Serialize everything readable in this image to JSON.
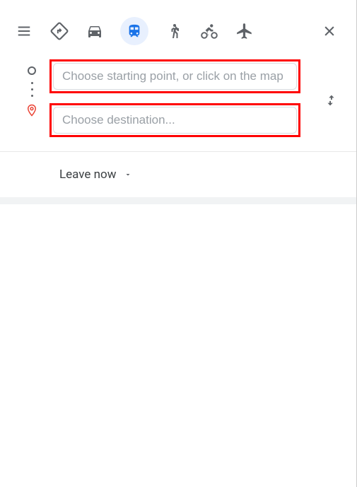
{
  "modes": {
    "best": "best",
    "driving": "driving",
    "transit": "transit",
    "walking": "walking",
    "cycling": "cycling",
    "flights": "flights"
  },
  "inputs": {
    "start_placeholder": "Choose starting point, or click on the map",
    "destination_placeholder": "Choose destination..."
  },
  "schedule": {
    "label": "Leave now"
  }
}
